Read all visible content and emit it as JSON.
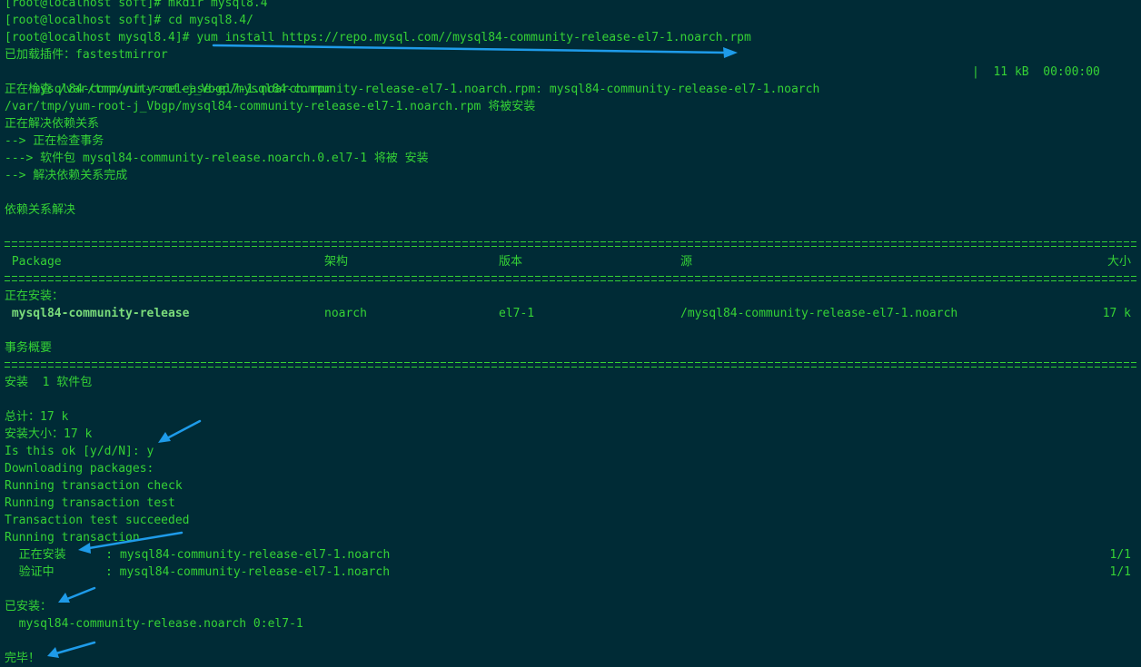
{
  "terminal": {
    "lines": {
      "l1": "[root@localhost soft]# mkdir mysql8.4",
      "l2": "[root@localhost soft]# cd mysql8.4/",
      "l3": "[root@localhost mysql8.4]# yum install https://repo.mysql.com//mysql84-community-release-el7-1.noarch.rpm",
      "l4": "已加载插件：fastestmirror",
      "l5_left": "mysql84-community-release-el7-1.noarch.rpm",
      "l5_right": "|  11 kB  00:00:00",
      "l6": "正在检查 /var/tmp/yum-root-j_Vbgp/mysql84-community-release-el7-1.noarch.rpm: mysql84-community-release-el7-1.noarch",
      "l7": "/var/tmp/yum-root-j_Vbgp/mysql84-community-release-el7-1.noarch.rpm 将被安装",
      "l8": "正在解决依赖关系",
      "l9": "--> 正在检查事务",
      "l10": "---> 软件包 mysql84-community-release.noarch.0.el7-1 将被 安装",
      "l11": "--> 解决依赖关系完成",
      "l13": "依赖关系解决",
      "installing_header": "正在安装：",
      "summary_header": "事务概要",
      "summary_install": "安装  1 软件包",
      "total": "总计：17 k",
      "install_size": "安装大小：17 k",
      "prompt": "Is this ok [y/d/N]: y",
      "download": "Downloading packages:",
      "check": "Running transaction check",
      "test": "Running transaction test",
      "test_ok": "Transaction test succeeded",
      "running": "Running transaction",
      "installing_step_label": "  正在安装",
      "installing_step_pkg": "    : mysql84-community-release-el7-1.noarch",
      "installing_step_count": "1/1",
      "verify_step_label": "  验证中",
      "verify_step_pkg": "      : mysql84-community-release-el7-1.noarch",
      "verify_step_count": "1/1",
      "installed_header": "已安装：",
      "installed_pkg": "  mysql84-community-release.noarch 0:el7-1",
      "done": "完毕！"
    },
    "table": {
      "headers": {
        "package": " Package",
        "arch": "架构",
        "version": "版本",
        "repo": "源",
        "size": "大小"
      },
      "row": {
        "package": " mysql84-community-release",
        "arch": "noarch",
        "version": "el7-1",
        "repo": "/mysql84-community-release-el7-1.noarch",
        "size": "17 k"
      }
    },
    "colors": {
      "background": "#002b36",
      "text": "#35d235",
      "annotation_arrow": "#1e9be9"
    }
  }
}
